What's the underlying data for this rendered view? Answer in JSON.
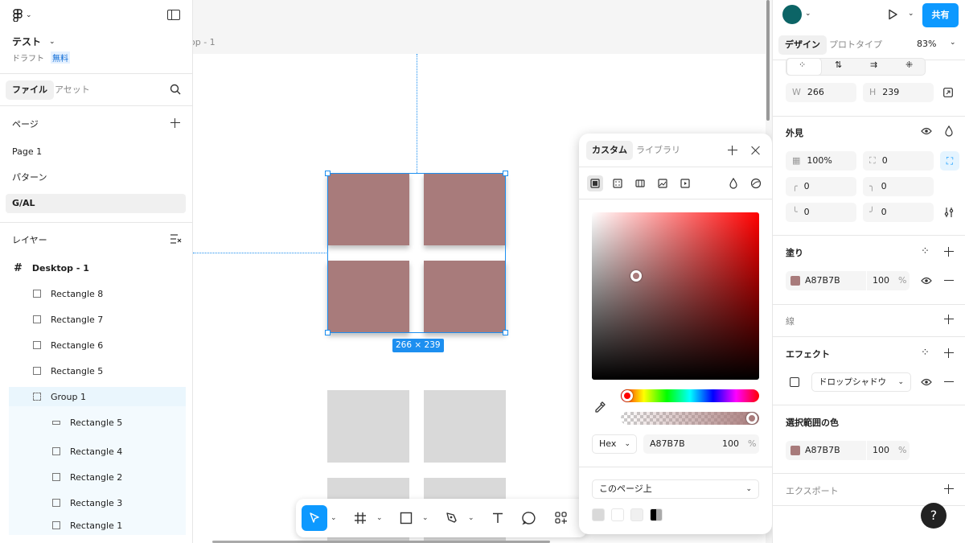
{
  "file": {
    "name": "テスト",
    "status": "ドラフト",
    "plan_badge": "無料"
  },
  "left_tabs": {
    "file": "ファイル",
    "assets": "アセット"
  },
  "pages": {
    "heading": "ページ",
    "items": [
      "Page 1",
      "パターン",
      "G/AL"
    ],
    "selected_index": 2
  },
  "layers": {
    "heading": "レイヤー",
    "items": [
      {
        "label": "Desktop - 1",
        "type": "frame"
      },
      {
        "label": "Rectangle 8",
        "type": "rect"
      },
      {
        "label": "Rectangle 7",
        "type": "rect"
      },
      {
        "label": "Rectangle 6",
        "type": "rect"
      },
      {
        "label": "Rectangle 5",
        "type": "rect"
      },
      {
        "label": "Group 1",
        "type": "group"
      },
      {
        "label": "Rectangle 5",
        "type": "line"
      },
      {
        "label": "Rectangle 4",
        "type": "rect"
      },
      {
        "label": "Rectangle 2",
        "type": "rect"
      },
      {
        "label": "Rectangle 3",
        "type": "rect"
      },
      {
        "label": "Rectangle 1",
        "type": "rect"
      }
    ]
  },
  "canvas": {
    "frame_label": "op - 1",
    "dimensions": "266 × 239",
    "fill_color": "#A87B7B"
  },
  "picker": {
    "tabs": {
      "custom": "カスタム",
      "library": "ライブラリ"
    },
    "format": "Hex",
    "hex": "A87B7B",
    "opacity": "100",
    "percent": "%",
    "scope": "このページ上",
    "swatches": [
      "#d9d9d9",
      "#ffffff",
      "#f0f0f0",
      "#000000"
    ]
  },
  "right": {
    "tabs": {
      "design": "デザイン",
      "prototype": "プロトタイプ"
    },
    "zoom": "83%",
    "share_label": "共有",
    "avatar_color": "#0c6466",
    "size": {
      "w_label": "W",
      "w": "266",
      "h_label": "H",
      "h": "239"
    },
    "appearance": {
      "heading": "外見",
      "opacity": "100%",
      "radius": "0",
      "corner_tl": "0",
      "corner_tr": "0",
      "corner_bl": "0",
      "corner_br": "0"
    },
    "fill": {
      "heading": "塗り",
      "hex": "A87B7B",
      "opacity": "100",
      "percent": "%"
    },
    "stroke": {
      "heading": "線"
    },
    "effects": {
      "heading": "エフェクト",
      "type": "ドロップシャドウ"
    },
    "selection_colors": {
      "heading": "選択範囲の色",
      "hex": "A87B7B",
      "opacity": "100",
      "percent": "%"
    },
    "export": {
      "heading": "エクスポート"
    },
    "help_label": "?"
  }
}
